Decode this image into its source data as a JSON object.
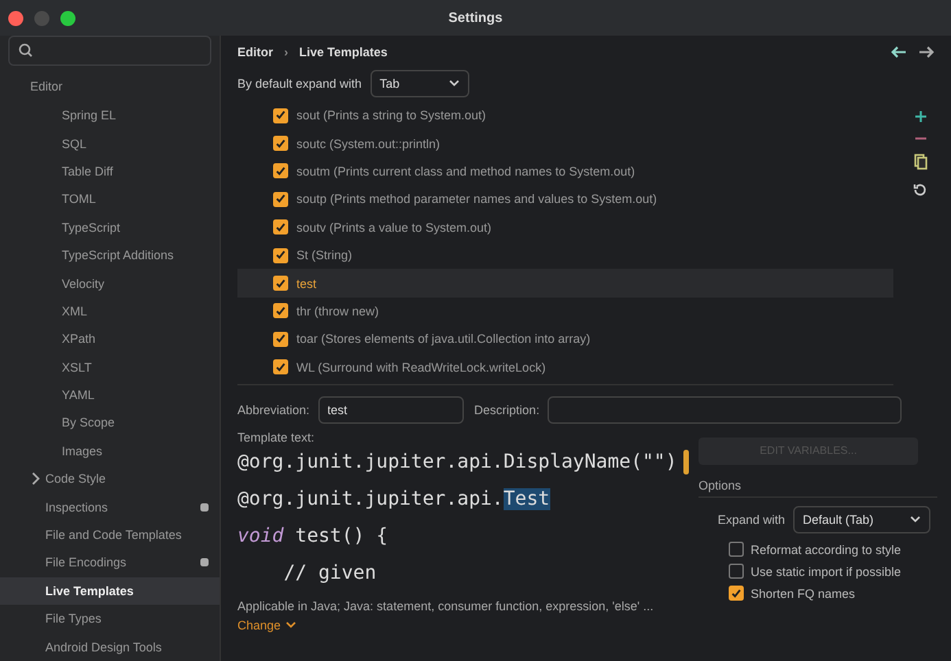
{
  "window": {
    "title": "Settings"
  },
  "sidebar": {
    "section": "Editor",
    "items": [
      {
        "label": "Spring EL",
        "kind": "sub",
        "selected": false,
        "badge": false,
        "expandable": false
      },
      {
        "label": "SQL",
        "kind": "sub",
        "selected": false,
        "badge": false,
        "expandable": false
      },
      {
        "label": "Table Diff",
        "kind": "sub",
        "selected": false,
        "badge": false,
        "expandable": false
      },
      {
        "label": "TOML",
        "kind": "sub",
        "selected": false,
        "badge": false,
        "expandable": false
      },
      {
        "label": "TypeScript",
        "kind": "sub",
        "selected": false,
        "badge": false,
        "expandable": false
      },
      {
        "label": "TypeScript Additions",
        "kind": "sub",
        "selected": false,
        "badge": false,
        "expandable": false
      },
      {
        "label": "Velocity",
        "kind": "sub",
        "selected": false,
        "badge": false,
        "expandable": false
      },
      {
        "label": "XML",
        "kind": "sub",
        "selected": false,
        "badge": false,
        "expandable": false
      },
      {
        "label": "XPath",
        "kind": "sub",
        "selected": false,
        "badge": false,
        "expandable": false
      },
      {
        "label": "XSLT",
        "kind": "sub",
        "selected": false,
        "badge": false,
        "expandable": false
      },
      {
        "label": "YAML",
        "kind": "sub",
        "selected": false,
        "badge": false,
        "expandable": false
      },
      {
        "label": "By Scope",
        "kind": "sub",
        "selected": false,
        "badge": false,
        "expandable": false
      },
      {
        "label": "Images",
        "kind": "sub",
        "selected": false,
        "badge": false,
        "expandable": false
      },
      {
        "label": "Code Style",
        "kind": "top",
        "selected": false,
        "badge": false,
        "expandable": true
      },
      {
        "label": "Inspections",
        "kind": "top",
        "selected": false,
        "badge": true,
        "expandable": false
      },
      {
        "label": "File and Code Templates",
        "kind": "top",
        "selected": false,
        "badge": false,
        "expandable": false
      },
      {
        "label": "File Encodings",
        "kind": "top",
        "selected": false,
        "badge": true,
        "expandable": false
      },
      {
        "label": "Live Templates",
        "kind": "top",
        "selected": true,
        "badge": false,
        "expandable": false
      },
      {
        "label": "File Types",
        "kind": "top",
        "selected": false,
        "badge": false,
        "expandable": false
      },
      {
        "label": "Android Design Tools",
        "kind": "top",
        "selected": false,
        "badge": false,
        "expandable": false
      }
    ]
  },
  "breadcrumb": [
    "Editor",
    "Live Templates"
  ],
  "breadcrumb_separator": "›",
  "expand_default": {
    "label": "By default expand with",
    "value": "Tab"
  },
  "templates": [
    {
      "label": "sout (Prints a string to System.out)",
      "checked": true,
      "selected": false
    },
    {
      "label": "soutc (System.out::println)",
      "checked": true,
      "selected": false
    },
    {
      "label": "soutm (Prints current class and method names to System.out)",
      "checked": true,
      "selected": false
    },
    {
      "label": "soutp (Prints method parameter names and values to System.out)",
      "checked": true,
      "selected": false
    },
    {
      "label": "soutv (Prints a value to System.out)",
      "checked": true,
      "selected": false
    },
    {
      "label": "St (String)",
      "checked": true,
      "selected": false
    },
    {
      "label": "test",
      "checked": true,
      "selected": true
    },
    {
      "label": "thr (throw new)",
      "checked": true,
      "selected": false
    },
    {
      "label": "toar (Stores elements of java.util.Collection into array)",
      "checked": true,
      "selected": false
    },
    {
      "label": "WL (Surround with ReadWriteLock.writeLock)",
      "checked": true,
      "selected": false
    }
  ],
  "abbreviation": {
    "label": "Abbreviation:",
    "value": "test"
  },
  "description": {
    "label": "Description:"
  },
  "template_text": {
    "label": "Template text:",
    "lines": [
      "@org.junit.jupiter.api.DisplayName(\"\")",
      "@org.junit.jupiter.api.**Test**",
      "*void* test() {",
      "    // given"
    ]
  },
  "edit_variables": {
    "label": "EDIT VARIABLES...",
    "disabled": true
  },
  "applicable": {
    "text": "Applicable in Java; Java: statement, consumer function, expression, 'else' ...",
    "link": "Change"
  },
  "options": {
    "title": "Options",
    "expand_with": {
      "label": "Expand with",
      "value": "Default (Tab)"
    },
    "checks": [
      {
        "label": "Reformat according to style",
        "checked": false
      },
      {
        "label": "Use static import if possible",
        "checked": false
      },
      {
        "label": "Shorten FQ names",
        "checked": true
      }
    ]
  }
}
